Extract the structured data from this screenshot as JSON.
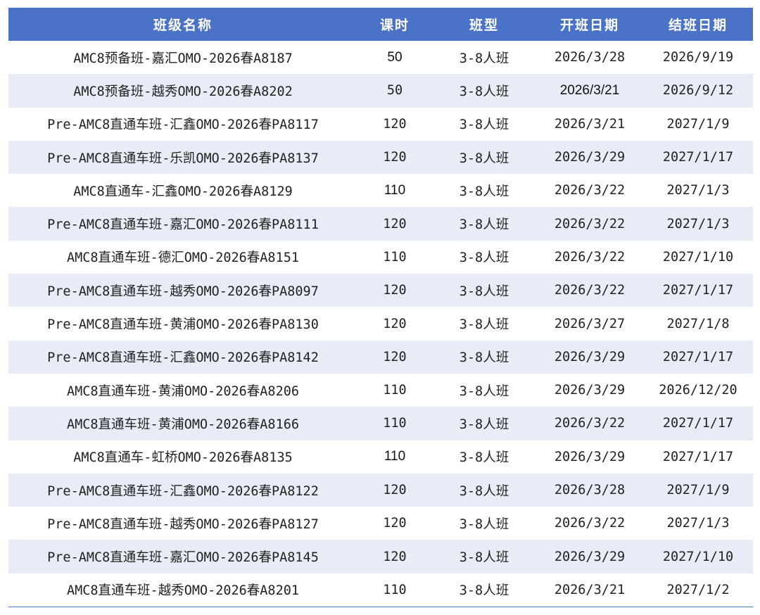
{
  "table": {
    "headers": [
      "班级名称",
      "课时",
      "班型",
      "开班日期",
      "结班日期"
    ],
    "rows": [
      [
        "AMC8预备班-嘉汇OMO-2026春A8187",
        "50",
        "3-8人班",
        "2026/3/28",
        "2026/9/19"
      ],
      [
        "AMC8预备班-越秀OMO-2026春A8202",
        "50",
        "3-8人班",
        "2026/3/21",
        "2026/9/12"
      ],
      [
        "Pre-AMC8直通车班-汇鑫OMO-2026春PA8117",
        "120",
        "3-8人班",
        "2026/3/21",
        "2027/1/9"
      ],
      [
        "Pre-AMC8直通车班-乐凯OMO-2026春PA8137",
        "120",
        "3-8人班",
        "2026/3/29",
        "2027/1/17"
      ],
      [
        "AMC8直通车-汇鑫OMO-2026春A8129",
        "110",
        "3-8人班",
        "2026/3/22",
        "2027/1/3"
      ],
      [
        "Pre-AMC8直通车班-嘉汇OMO-2026春PA8111",
        "120",
        "3-8人班",
        "2026/3/22",
        "2027/1/3"
      ],
      [
        "AMC8直通车班-德汇OMO-2026春A8151",
        "110",
        "3-8人班",
        "2026/3/22",
        "2027/1/10"
      ],
      [
        "Pre-AMC8直通车班-越秀OMO-2026春PA8097",
        "120",
        "3-8人班",
        "2026/3/22",
        "2027/1/17"
      ],
      [
        "Pre-AMC8直通车班-黄浦OMO-2026春PA8130",
        "120",
        "3-8人班",
        "2026/3/27",
        "2027/1/8"
      ],
      [
        "Pre-AMC8直通车班-汇鑫OMO-2026春PA8142",
        "120",
        "3-8人班",
        "2026/3/29",
        "2027/1/17"
      ],
      [
        "AMC8直通车班-黄浦OMO-2026春A8206",
        "110",
        "3-8人班",
        "2026/3/29",
        "2026/12/20"
      ],
      [
        "AMC8直通车班-黄浦OMO-2026春A8166",
        "110",
        "3-8人班",
        "2026/3/22",
        "2027/1/17"
      ],
      [
        "AMC8直通车-虹桥OMO-2026春A8135",
        "110",
        "3-8人班",
        "2026/3/29",
        "2027/1/17"
      ],
      [
        "Pre-AMC8直通车班-汇鑫OMO-2026春PA8122",
        "120",
        "3-8人班",
        "2026/3/28",
        "2027/1/9"
      ],
      [
        "Pre-AMC8直通车班-越秀OMO-2026春PA8127",
        "120",
        "3-8人班",
        "2026/3/22",
        "2027/1/3"
      ],
      [
        "Pre-AMC8直通车班-嘉汇OMO-2026春PA8145",
        "120",
        "3-8人班",
        "2026/3/29",
        "2027/1/10"
      ],
      [
        "AMC8直通车班-越秀OMO-2026春A8201",
        "110",
        "3-8人班",
        "2026/3/21",
        "2027/1/2"
      ]
    ]
  },
  "colors": {
    "header_bg": "#4a72c6",
    "header_text": "#ffffff",
    "alt_row_bg": "#e7ecf7",
    "body_text": "#222222"
  }
}
